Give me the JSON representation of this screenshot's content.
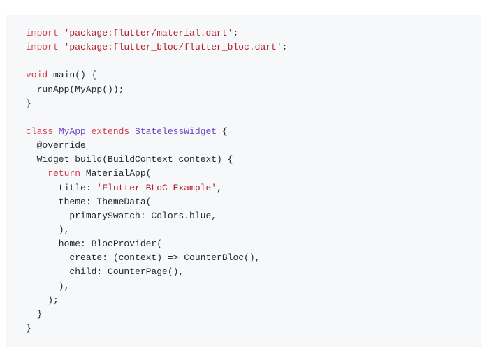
{
  "code": {
    "tokens": [
      [
        {
          "t": "import ",
          "c": "kw"
        },
        {
          "t": "'package:flutter/material.dart'",
          "c": "str"
        },
        {
          "t": ";",
          "c": "ident"
        }
      ],
      [
        {
          "t": "import ",
          "c": "kw"
        },
        {
          "t": "'package:flutter_bloc/flutter_bloc.dart'",
          "c": "str"
        },
        {
          "t": ";",
          "c": "ident"
        }
      ],
      [],
      [
        {
          "t": "void ",
          "c": "kw"
        },
        {
          "t": "main() {",
          "c": "ident"
        }
      ],
      [
        {
          "t": "  runApp(MyApp());",
          "c": "ident"
        }
      ],
      [
        {
          "t": "}",
          "c": "ident"
        }
      ],
      [],
      [
        {
          "t": "class ",
          "c": "kw"
        },
        {
          "t": "MyApp ",
          "c": "type"
        },
        {
          "t": "extends ",
          "c": "kw"
        },
        {
          "t": "StatelessWidget ",
          "c": "type"
        },
        {
          "t": "{",
          "c": "ident"
        }
      ],
      [
        {
          "t": "  @override",
          "c": "anno"
        }
      ],
      [
        {
          "t": "  Widget build(BuildContext context) {",
          "c": "ident"
        }
      ],
      [
        {
          "t": "    ",
          "c": "ident"
        },
        {
          "t": "return ",
          "c": "kw"
        },
        {
          "t": "MaterialApp(",
          "c": "ident"
        }
      ],
      [
        {
          "t": "      title: ",
          "c": "ident"
        },
        {
          "t": "'Flutter BLoC Example'",
          "c": "str"
        },
        {
          "t": ",",
          "c": "ident"
        }
      ],
      [
        {
          "t": "      theme: ThemeData(",
          "c": "ident"
        }
      ],
      [
        {
          "t": "        primarySwatch: Colors.blue,",
          "c": "ident"
        }
      ],
      [
        {
          "t": "      ),",
          "c": "ident"
        }
      ],
      [
        {
          "t": "      home: BlocProvider(",
          "c": "ident"
        }
      ],
      [
        {
          "t": "        create: (context) => CounterBloc(),",
          "c": "ident"
        }
      ],
      [
        {
          "t": "        child: CounterPage(),",
          "c": "ident"
        }
      ],
      [
        {
          "t": "      ),",
          "c": "ident"
        }
      ],
      [
        {
          "t": "    );",
          "c": "ident"
        }
      ],
      [
        {
          "t": "  }",
          "c": "ident"
        }
      ],
      [
        {
          "t": "}",
          "c": "ident"
        }
      ]
    ]
  }
}
